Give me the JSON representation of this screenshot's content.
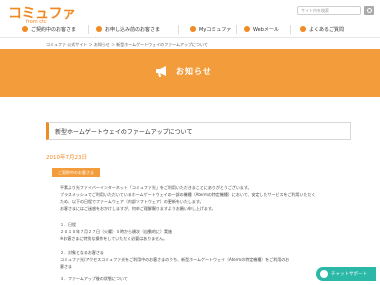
{
  "header": {
    "logo": "コミュファ",
    "logo_sub": "from ctc",
    "search_placeholder": "サイト内を検索"
  },
  "nav": {
    "items": [
      {
        "label": "ご契約中のお客さま"
      },
      {
        "label": "お申し込み前のお客さま"
      },
      {
        "label": "Myコミュファ"
      },
      {
        "label": "Webメール"
      },
      {
        "label": "よくあるご質問"
      }
    ]
  },
  "breadcrumb": "コミュファ 公式サイト ＞ お知らせ ＞ 新型ホームゲートウェイのファームアップについて",
  "banner": {
    "title": "お知らせ",
    "accent_color": "#f39c3c"
  },
  "article": {
    "title": "新型ホームゲートウェイのファームアップについて",
    "date": "2010年7月23日",
    "tag": "ご契約中のお客さま",
    "lines": [
      "平素より光ファイバーインターネット「コミュファ光」をご利用いただきまことにありがとうございます。",
      "ブラスメッシュでご利用いただいているホームゲートウェイの一部の機種（Atermの特定機種）において、安定したサービスをご利用いただく",
      "ため、以下の日程でファームウェア（内部ソフトウェア）の更新をいたします。",
      "お客さまにはご迷惑をおかけしますが、何卒ご理解賜りますようお願い申し上げます。",
      "１．日程",
      "２０１０年７月２７日（火曜）０時から順次（自動的に）実施",
      "※お客さまに特別な操作をしていただく必要はありません。",
      "２．対象となるお客さま",
      "コミュファ光/アクセスコミュファ光をご利用中のお客さまのうち、新型ホームゲートウェイ（Atermの特定機種）をご利用のお",
      "客さま",
      "３．ファームアップ後の状態について"
    ]
  },
  "chat": {
    "label": "チャットサポート",
    "color": "#2bb8a6"
  }
}
